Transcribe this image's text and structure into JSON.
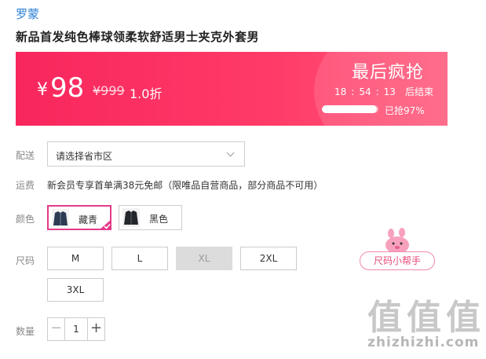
{
  "brand": "罗蒙",
  "title": "新品首发纯色棒球领柔软舒适男士夹克外套男",
  "promo": {
    "currency": "¥",
    "price": "98",
    "original_price": "¥999",
    "discount": "1.0折",
    "title": "最后疯抢",
    "countdown": {
      "h": "18",
      "m": "54",
      "s": "13",
      "suffix": "后结束"
    },
    "progress_percent": 97,
    "sold_text": "已抢97%",
    "colors": {
      "banner": "#f8265d",
      "accent": "#ffffff"
    }
  },
  "delivery": {
    "label": "配送",
    "placeholder": "请选择省市区",
    "icon": "chevron-down-icon"
  },
  "shipping": {
    "label": "运费",
    "text": "新会员专享首单满38元免邮（限唯品自营商品，部分商品不可用）"
  },
  "color": {
    "label": "颜色",
    "options": [
      {
        "name": "藏青",
        "selected": true
      },
      {
        "name": "黑色",
        "selected": false
      }
    ]
  },
  "size": {
    "label": "尺码",
    "options": [
      {
        "name": "M",
        "disabled": false
      },
      {
        "name": "L",
        "disabled": false
      },
      {
        "name": "XL",
        "disabled": true
      },
      {
        "name": "2XL",
        "disabled": false
      },
      {
        "name": "3XL",
        "disabled": false
      }
    ],
    "helper_label": "尺码小帮手"
  },
  "quantity": {
    "label": "数量",
    "value": "1",
    "minus": "−",
    "plus": "+"
  },
  "watermark": {
    "glyphs": "值",
    "text": "zhizhizhi.com"
  },
  "accent_pink": "#e43a8a"
}
